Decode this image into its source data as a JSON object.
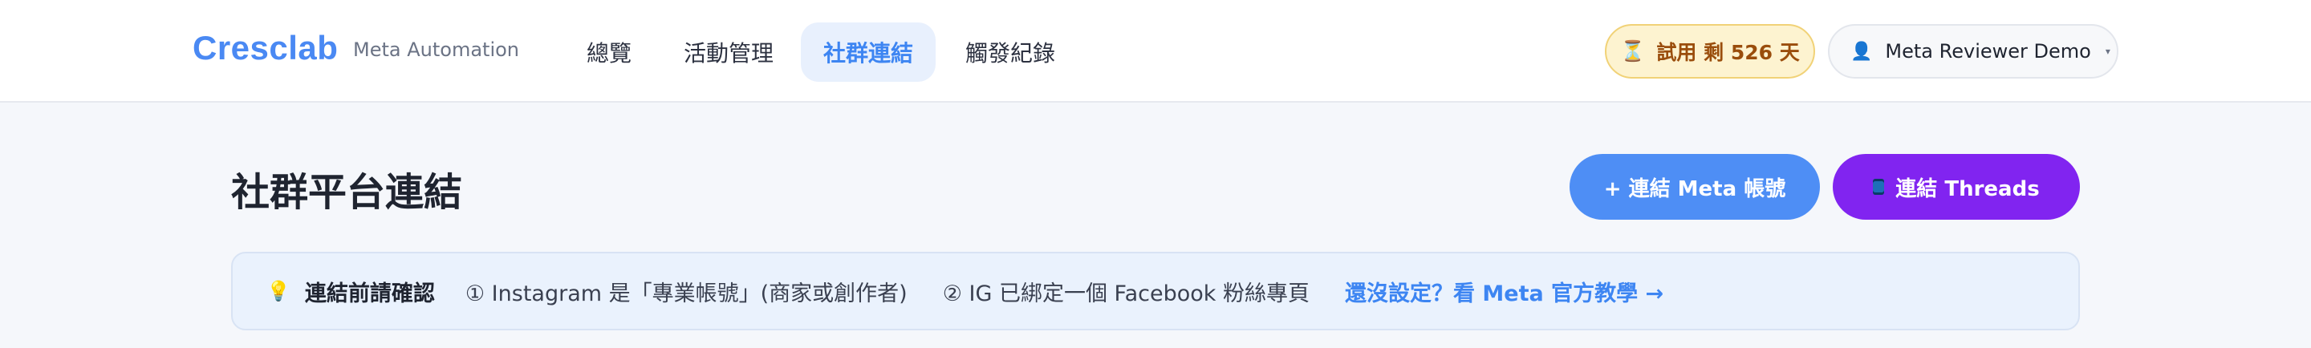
{
  "header": {
    "logo": "Cresclab",
    "subtitle": "Meta Automation",
    "tabs": [
      {
        "label": "總覽"
      },
      {
        "label": "活動管理"
      },
      {
        "label": "社群連結"
      },
      {
        "label": "觸發紀錄"
      }
    ],
    "trial": {
      "icon": "hourglass-icon",
      "label": "試用 剩 526 天"
    },
    "user": {
      "icon": "person-icon",
      "name": "Meta Reviewer Demo",
      "caret": "▾"
    }
  },
  "main": {
    "title": "社群平台連結",
    "buttons": {
      "connect_meta": "+ 連結 Meta 帳號",
      "connect_threads": "連結 Threads"
    },
    "notice": {
      "title": "連結前請確認",
      "item1": "① Instagram 是「專業帳號」(商家或創作者)",
      "item2": "② IG 已綁定一個 Facebook 粉絲專頁",
      "link": "還沒設定？看 Meta 官方教學 →"
    }
  },
  "colors": {
    "accent": "#4a89f3",
    "threads_purple": "#8124f0",
    "trial_bg": "#fdf3d0",
    "notice_bg": "#eaf2fd"
  }
}
